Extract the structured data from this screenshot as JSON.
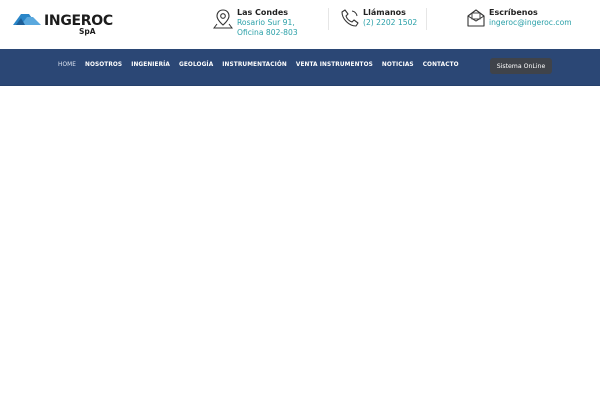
{
  "brand": {
    "name": "INGEROC",
    "suffix": "SpA",
    "accent": "#2a86c8"
  },
  "contact": [
    {
      "icon": "location-pin-icon",
      "title": "Las Condes",
      "detail": "Rosario Sur 91, Oficina 802-803"
    },
    {
      "icon": "phone-icon",
      "title": "Llámanos",
      "detail": "(2) 2202 1502"
    },
    {
      "icon": "envelope-icon",
      "title": "Escríbenos",
      "detail": "ingeroc@ingeroc.com"
    }
  ],
  "nav": {
    "items": [
      "HOME",
      "NOSOTROS",
      "INGENIERÍA",
      "GEOLOGÍA",
      "INSTRUMENTACIÓN",
      "VENTA INSTRUMENTOS",
      "NOTICIAS",
      "CONTACTO"
    ],
    "active": "HOME",
    "cta": "Sistema OnLine"
  },
  "colors": {
    "nav_bg": "#2b4775",
    "link": "#2aa0a8",
    "cta_bg": "#3f434a"
  }
}
